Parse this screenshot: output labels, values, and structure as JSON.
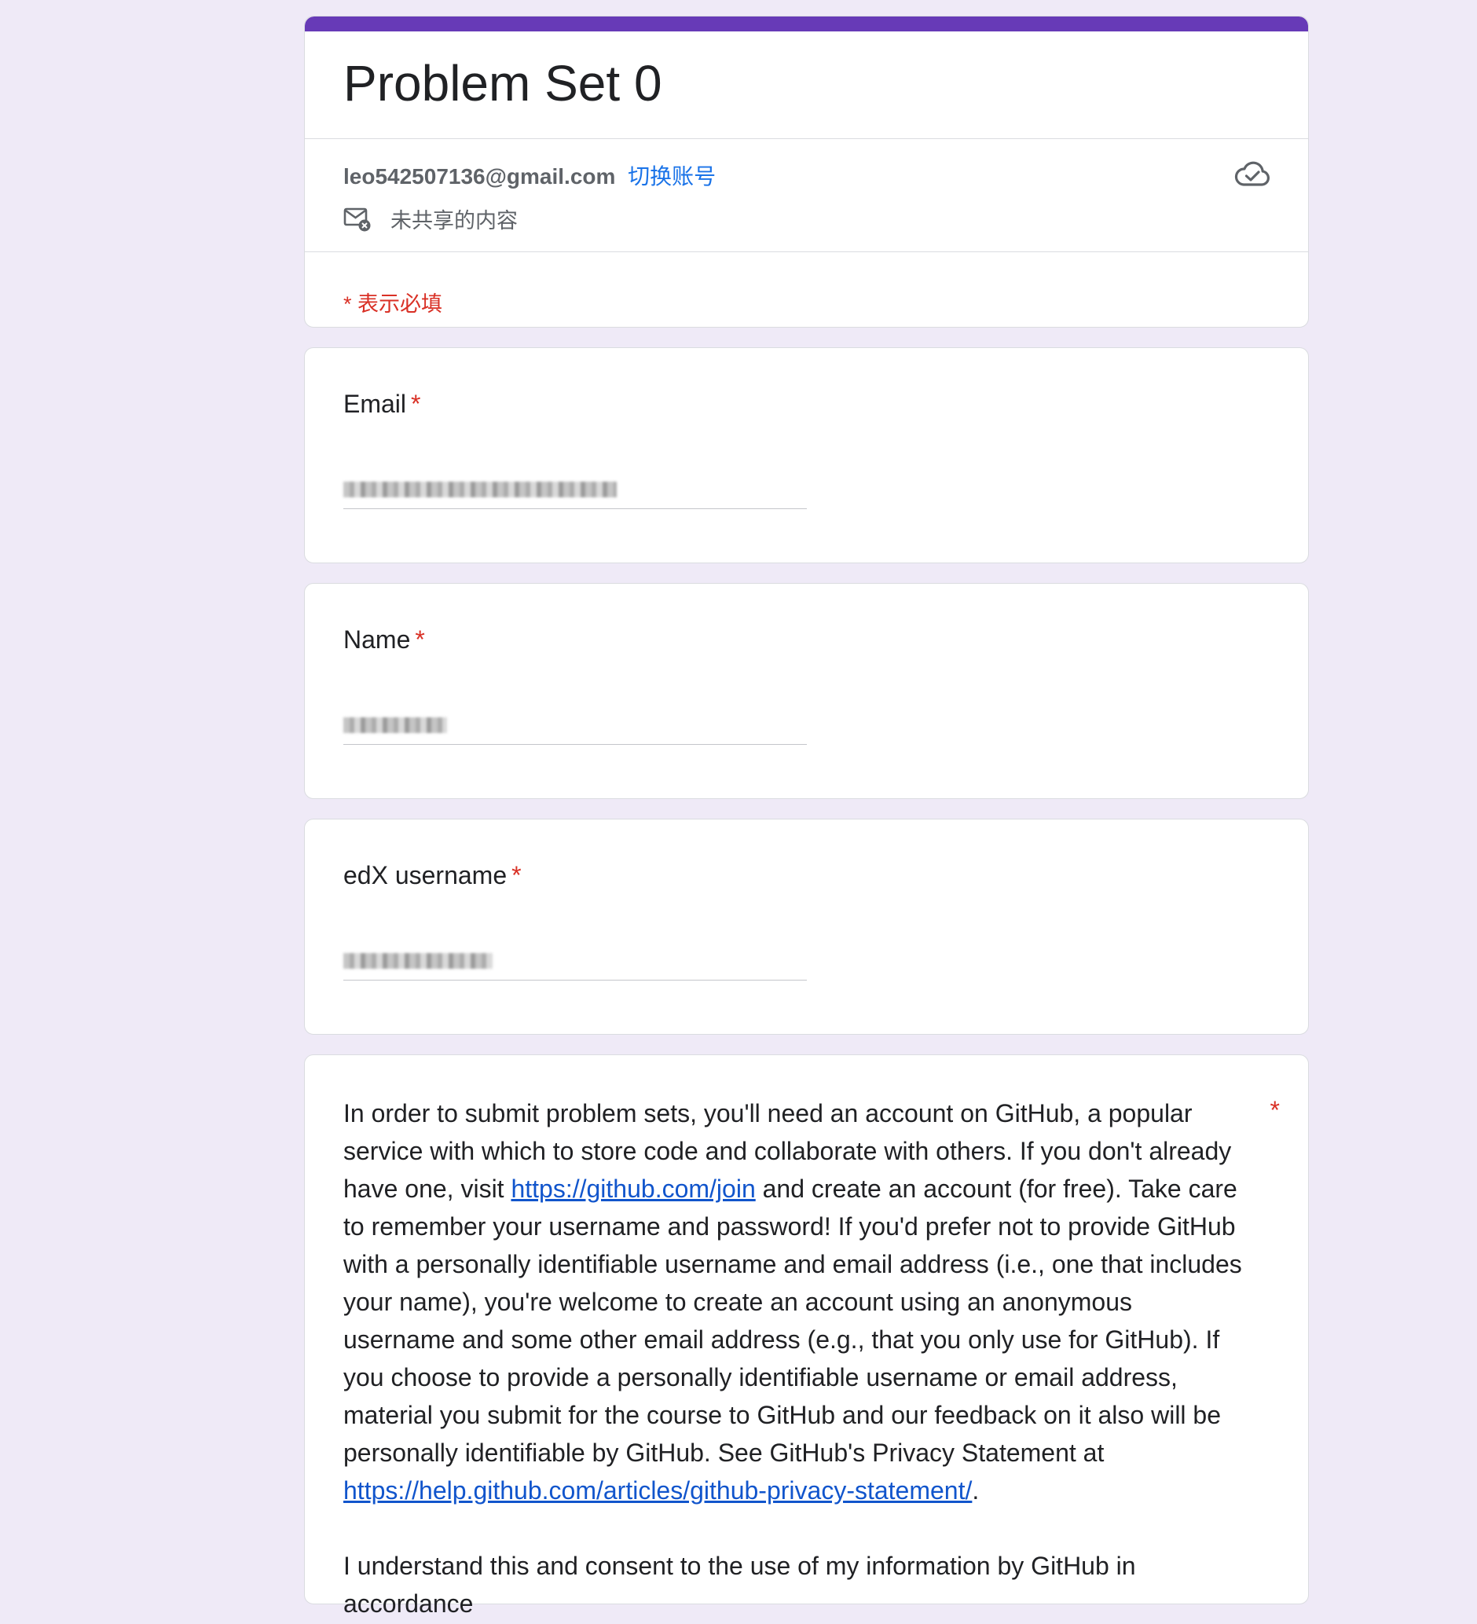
{
  "form": {
    "title": "Problem Set 0",
    "account_email": "leo542507136@gmail.com",
    "switch_account": "切换账号",
    "not_shared": "未共享的内容",
    "required_note": "* 表示必填"
  },
  "questions": [
    {
      "label": "Email",
      "required": "*"
    },
    {
      "label": "Name",
      "required": "*"
    },
    {
      "label": "edX username",
      "required": "*"
    }
  ],
  "github_question": {
    "required": "*",
    "text_1": "In order to submit problem sets, you'll need an account on GitHub, a popular service with which to store code and collaborate with others. If you don't already have one, visit ",
    "link_1": "https://github.com/join",
    "text_2": " and create an account (for free). Take care to remember your username and password! If you'd prefer not to provide GitHub with a personally identifiable username and email address (i.e., one that includes your name), you're welcome to create an account using an anonymous username and some other email address (e.g., that you only use for GitHub). If you choose to provide a personally identifiable username or email address, material you submit for the course to GitHub and our feedback on it also will be personally identifiable by GitHub. See GitHub's Privacy Statement at ",
    "link_2": "https://help.github.com/articles/github-privacy-statement/",
    "text_3": ".",
    "para2": "I understand this and consent to the use of my information by GitHub in accordance"
  },
  "colors": {
    "accent": "#673ab7",
    "background": "#efeaf7",
    "required": "#d93025",
    "link": "#1a73e8"
  },
  "icons": [
    "cloud-check-icon",
    "mail-not-shared-icon"
  ]
}
